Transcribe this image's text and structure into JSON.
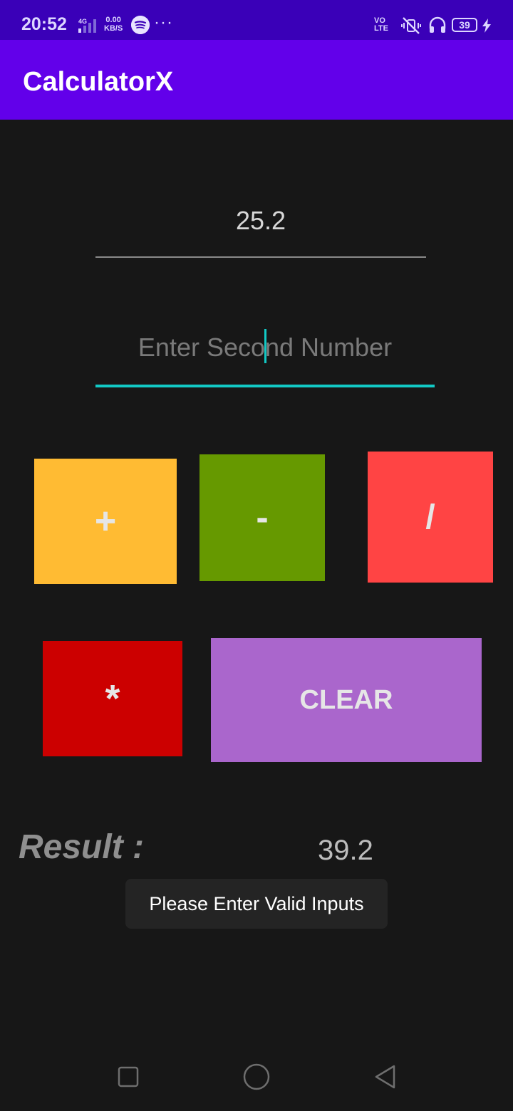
{
  "status_bar": {
    "time": "20:52",
    "network": "4G",
    "speed_value": "0.00",
    "speed_unit": "KB/S",
    "more": "···",
    "volte": "VO LTE",
    "battery": "39"
  },
  "app_bar": {
    "title": "CalculatorX"
  },
  "inputs": {
    "first_value": "25.2",
    "second_placeholder": "Enter Second Number",
    "second_value": ""
  },
  "buttons": {
    "add": "+",
    "subtract": "-",
    "divide": "/",
    "multiply": "*",
    "clear": "CLEAR"
  },
  "result": {
    "label": "Result :",
    "value": "39.2"
  },
  "toast": {
    "message": "Please Enter Valid Inputs"
  },
  "colors": {
    "status_bar": "#3a00b8",
    "app_bar": "#6200ea",
    "background": "#171717",
    "accent": "#12c9c5",
    "add": "#ffbb33",
    "subtract": "#669900",
    "divide": "#ff4444",
    "multiply": "#cc0000",
    "clear": "#aa66cc"
  },
  "icons": {
    "nav_recents": "square-icon",
    "nav_home": "circle-icon",
    "nav_back": "triangle-back-icon"
  }
}
